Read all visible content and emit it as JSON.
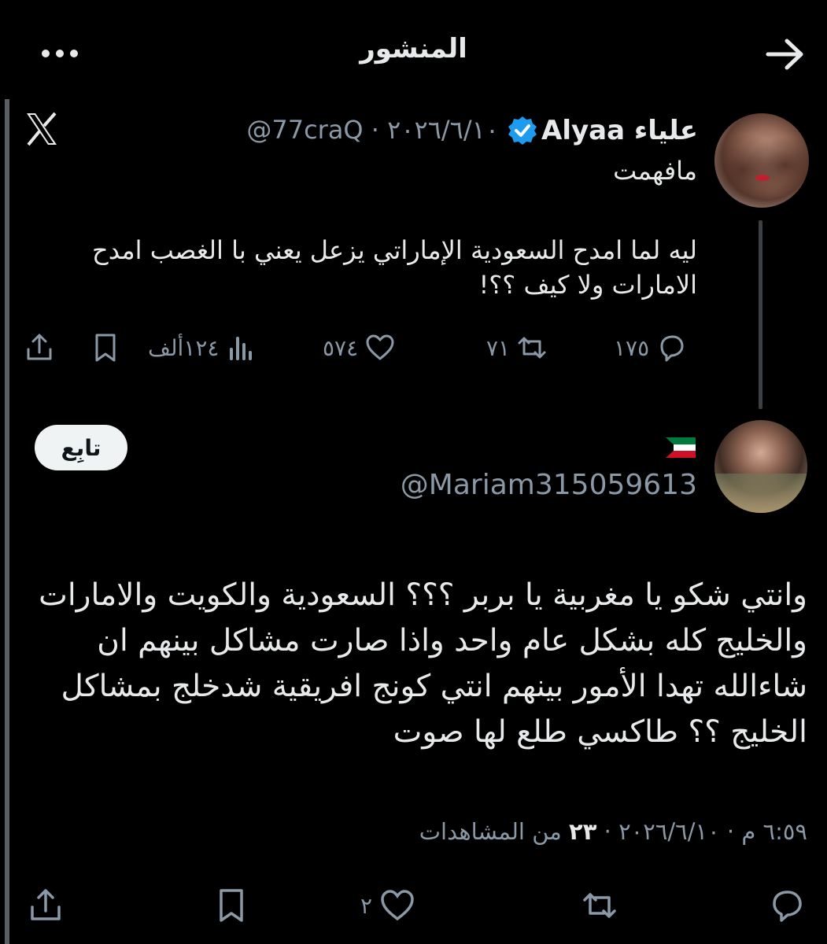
{
  "header": {
    "title": "المنشور",
    "back_icon": "arrow-right-icon",
    "more_icon": "more-dots-icon"
  },
  "quoted": {
    "name": "علياء Alyaa",
    "handle_time": "@77craQ · ٢٠٢٦/٦/١٠",
    "reply_text": "مافهمت",
    "body": "ليه لما امدح السعودية الإماراتي يزعل يعني با الغصب امدح الامارات ولا كيف ؟؟!",
    "stats": {
      "replies": "١٧٥",
      "reposts": "٧١",
      "likes": "٥٧٤",
      "views": "١٢٤ألف"
    }
  },
  "main": {
    "handle": "@Mariam315059613",
    "follow_label": "تابِع",
    "body": "وانتي شكو يا مغربية يا بربر ؟؟؟ السعودية والكويت والامارات والخليج كله بشكل عام واحد واذا صارت مشاكل بينهم ان شاءالله تهدا الأمور بينهم انتي كونج افريقية شدخلج بمشاكل الخليج ؟؟ طاكسي طلع لها صوت",
    "meta_prefix": "٦:٥٩ م · ٢٠٢٦/٦/١٠ · ",
    "views_count": "٢٣",
    "views_suffix": " من المشاهدات",
    "likes": "٢"
  },
  "colors": {
    "background": "#000000",
    "text": "#e7e9ea",
    "muted": "#8b98a5",
    "verified": "#1d9bf0"
  }
}
